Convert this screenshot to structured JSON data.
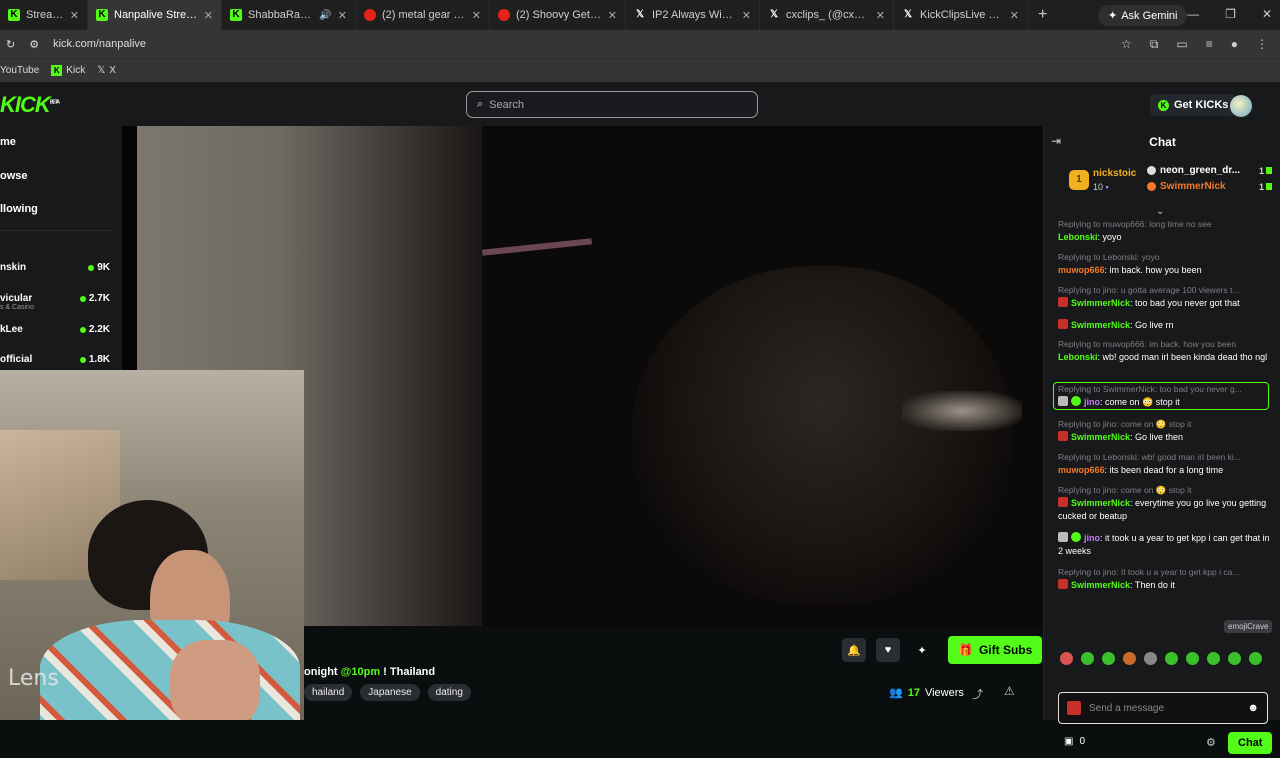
{
  "browser": {
    "tabs": [
      {
        "label": "Stream - Watch L",
        "icon": "kick",
        "active": false
      },
      {
        "label": "Nanpalive Stream - Wa",
        "icon": "kick",
        "active": true
      },
      {
        "label": "ShabbaRank - Watc",
        "icon": "kick",
        "active": false
      },
      {
        "label": "(2) metal gear solid lofi",
        "icon": "youtube",
        "active": false
      },
      {
        "label": "(2) Shoovy Gets CHOK",
        "icon": "youtube",
        "active": false
      },
      {
        "label": "IP2 Always Wins (@Ip2",
        "icon": "x",
        "active": false
      },
      {
        "label": "cxclips_ (@cx_clips) / X",
        "icon": "x",
        "active": false
      },
      {
        "label": "KickClipsLive on X: \"Va",
        "icon": "x",
        "active": false
      }
    ],
    "gemini_label": "Ask Gemini",
    "url": "kick.com/nanpalive",
    "bookmarks": [
      "YouTube",
      "Kick",
      "X"
    ]
  },
  "header": {
    "logo": "KICK",
    "logo_beta": "BETA",
    "search_placeholder": "Search",
    "get_kicks_label": "Get KICKs"
  },
  "sidebar": {
    "nav": [
      "me",
      "owse",
      "llowing"
    ],
    "channels": [
      {
        "name": "nskin",
        "sub": "",
        "viewers": "9K"
      },
      {
        "name": "vicular",
        "sub": "s & Casino",
        "viewers": "2.7K"
      },
      {
        "name": "kLee",
        "sub": "",
        "viewers": "2.2K"
      },
      {
        "name": "official",
        "sub": "",
        "viewers": "1.8K"
      }
    ]
  },
  "webcam": {
    "overlay_text": "Lens"
  },
  "stream": {
    "title_prefix": "onight ",
    "title_time": "@10pm",
    "title_suffix": " ! Thailand",
    "tags": [
      "hailand",
      "Japanese",
      "dating"
    ],
    "gift_subs_label": "Gift Subs",
    "viewer_count": "17",
    "viewer_label": "Viewers"
  },
  "chat": {
    "title": "Chat",
    "leaderboard": {
      "first": {
        "rank": "1",
        "name": "nickstoic",
        "score": "10"
      },
      "others": [
        {
          "name": "neon_green_dr...",
          "count": "1",
          "color": "#ffffff"
        },
        {
          "name": "SwimmerNick",
          "count": "1",
          "color": "#f5782a"
        }
      ]
    },
    "messages": [
      {
        "reply": "Replying to muwop666: long time no see",
        "user": "Lebonski",
        "color": "g",
        "text": ": yoyo",
        "badge": ""
      },
      {
        "reply": "Replying to Lebonski: yoyo",
        "user": "muwop666",
        "color": "o",
        "text": ": im back. how you been",
        "badge": ""
      },
      {
        "reply": "Replying to jino: u gotta average 100 viewers t...",
        "user": "SwimmerNick",
        "color": "g",
        "text": ": too bad you never got that",
        "badge": "red"
      },
      {
        "reply": "",
        "user": "SwimmerNick",
        "color": "g",
        "text": ": Go live rn",
        "badge": "red"
      },
      {
        "reply": "Replying to muwop666: im back. how you been",
        "user": "Lebonski",
        "color": "g",
        "text": ": wb! good man irl been kinda dead tho ngl",
        "badge": ""
      },
      {
        "reply": "Replying to SwimmerNick: too bad you never g...",
        "user": "jino",
        "color": "p",
        "text": ": come on 😳 stop it",
        "badge": "white",
        "highlight": true
      },
      {
        "reply": "Replying to jino: come on 😳 stop it",
        "user": "SwimmerNick",
        "color": "g",
        "text": ": Go live then",
        "badge": "red"
      },
      {
        "reply": "Replying to Lebonski: wb! good man irl been ki...",
        "user": "muwop666",
        "color": "o",
        "text": ": its been dead for a long time",
        "badge": ""
      },
      {
        "reply": "Replying to jino: come on 😳 stop it",
        "user": "SwimmerNick",
        "color": "g",
        "text": ": everytime you go live you getting cucked or beatup",
        "badge": "red"
      },
      {
        "reply": "",
        "user": "jino",
        "color": "p",
        "text": ": it took u a year to get kpp i can get that in 2 weeks",
        "badge": "white"
      },
      {
        "reply": "Replying to jino: It took u a year to get kpp i ca...",
        "user": "SwimmerNick",
        "color": "g",
        "text": ": Then do it",
        "badge": "red"
      }
    ],
    "emoji_tooltip": "emojiCrave",
    "input_placeholder": "Send a message",
    "kicks_count": "0",
    "send_label": "Chat"
  }
}
